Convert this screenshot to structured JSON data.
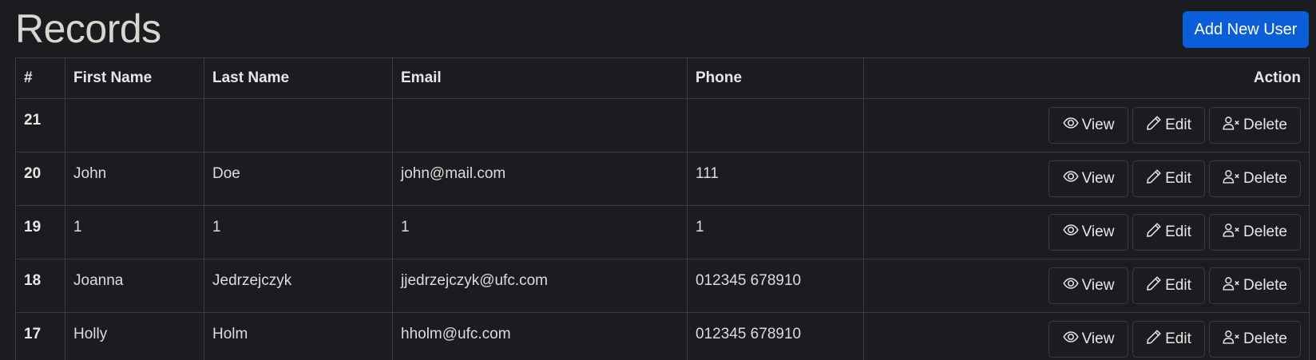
{
  "page": {
    "title": "Records",
    "add_button_label": "Add New User"
  },
  "table": {
    "headers": [
      "#",
      "First Name",
      "Last Name",
      "Email",
      "Phone",
      "Action"
    ],
    "rows": [
      {
        "id": "21",
        "first": "",
        "last": "",
        "email": "",
        "phone": ""
      },
      {
        "id": "20",
        "first": "John",
        "last": "Doe",
        "email": "john@mail.com",
        "phone": "111"
      },
      {
        "id": "19",
        "first": "1",
        "last": "1",
        "email": "1",
        "phone": "1"
      },
      {
        "id": "18",
        "first": "Joanna",
        "last": "Jedrzejczyk",
        "email": "jjedrzejczyk@ufc.com",
        "phone": "012345 678910"
      },
      {
        "id": "17",
        "first": "Holly",
        "last": "Holm",
        "email": "hholm@ufc.com",
        "phone": "012345 678910"
      }
    ],
    "actions": {
      "view_label": "View",
      "edit_label": "Edit",
      "delete_label": "Delete",
      "view_icon": "eye-icon",
      "edit_icon": "pencil-icon",
      "delete_icon": "person-x-icon"
    }
  },
  "colors": {
    "background": "#1b1c1f",
    "primary_button": "#0b5ed7",
    "border": "#3a3c40"
  }
}
